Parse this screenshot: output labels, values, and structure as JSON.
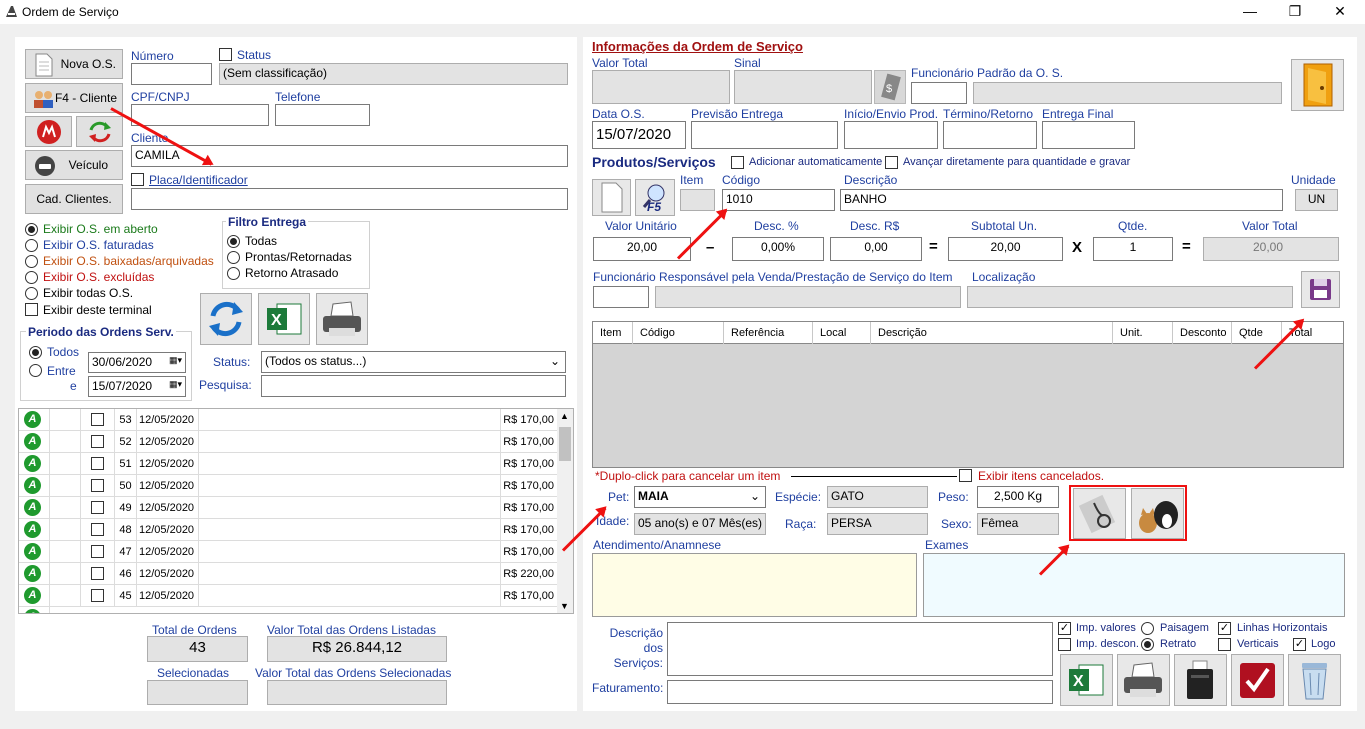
{
  "window": {
    "title": "Ordem de Serviço",
    "minimize": "—",
    "restore": "❐",
    "close": "✕"
  },
  "left": {
    "buttons": {
      "nova_os": "Nova O.S.",
      "f4_cliente": "F4 - Cliente",
      "veiculo": "Veículo",
      "cad_clientes": "Cad. Clientes."
    },
    "numero_label": "Número",
    "status_label": "Status",
    "status_value": "(Sem classificação)",
    "cpf_label": "CPF/CNPJ",
    "telefone_label": "Telefone",
    "cliente_label": "Cliente",
    "cliente_value": "CAMILA",
    "placa_label": "Placa/Identificador",
    "filters": [
      {
        "label": "Exibir O.S. em aberto",
        "color": "#1a7a1a",
        "on": true
      },
      {
        "label": "Exibir O.S. faturadas",
        "color": "#1f3fa0",
        "on": false
      },
      {
        "label": "Exibir O.S. baixadas/arquivadas",
        "color": "#c05010",
        "on": false
      },
      {
        "label": "Exibir O.S. excluídas",
        "color": "#c01010",
        "on": false
      },
      {
        "label": "Exibir todas O.S.",
        "color": "#000000",
        "on": false
      }
    ],
    "exibir_terminal": "Exibir deste terminal",
    "filtro_entrega": {
      "title": "Filtro Entrega",
      "options": [
        "Todas",
        "Prontas/Retornadas",
        "Retorno Atrasado"
      ]
    },
    "periodo": {
      "title": "Periodo das Ordens Serv.",
      "todos": "Todos",
      "entre": "Entre",
      "e": "e",
      "de": "30/06/2020",
      "ate": "15/07/2020"
    },
    "status_filter_label": "Status:",
    "status_filter_value": "(Todos os status...)",
    "pesquisa_label": "Pesquisa:",
    "orders": [
      {
        "num": "53",
        "date": "12/05/2020",
        "value": "R$ 170,00"
      },
      {
        "num": "52",
        "date": "12/05/2020",
        "value": "R$ 170,00"
      },
      {
        "num": "51",
        "date": "12/05/2020",
        "value": "R$ 170,00"
      },
      {
        "num": "50",
        "date": "12/05/2020",
        "value": "R$ 170,00"
      },
      {
        "num": "49",
        "date": "12/05/2020",
        "value": "R$ 170,00"
      },
      {
        "num": "48",
        "date": "12/05/2020",
        "value": "R$ 170,00"
      },
      {
        "num": "47",
        "date": "12/05/2020",
        "value": "R$ 170,00"
      },
      {
        "num": "46",
        "date": "12/05/2020",
        "value": "R$ 220,00"
      },
      {
        "num": "45",
        "date": "12/05/2020",
        "value": "R$ 170,00"
      }
    ],
    "order_icon_letter": "A",
    "totals": {
      "total_ordens_label": "Total de Ordens",
      "total_ordens": "43",
      "valor_total_label": "Valor Total das Ordens Listadas",
      "valor_total": "R$ 26.844,12",
      "selecionadas_label": "Selecionadas",
      "valor_sel_label": "Valor Total das Ordens Selecionadas"
    }
  },
  "right": {
    "info_title": "Informações da Ordem de Serviço",
    "valor_total_label": "Valor Total",
    "sinal_label": "Sinal",
    "func_padrao_label": "Funcionário Padrão da O. S.",
    "data_os_label": "Data O.S.",
    "data_os": "15/07/2020",
    "previsao_label": "Previsão Entrega",
    "inicio_label": "Início/Envio Prod.",
    "termino_label": "Término/Retorno",
    "entrega_label": "Entrega Final",
    "produtos_title": "Produtos/Serviços",
    "adicionar_auto": "Adicionar automaticamente",
    "avancar": "Avançar diretamente para quantidade e gravar",
    "item_label": "Item",
    "codigo_label": "Código",
    "codigo": "1010",
    "descricao_label": "Descrição",
    "descricao": "BANHO",
    "unidade_label": "Unidade",
    "unidade": "UN",
    "valor_unit_label": "Valor Unitário",
    "valor_unit": "20,00",
    "desc_pct_label": "Desc. %",
    "desc_pct": "0,00%",
    "desc_rs_label": "Desc. R$",
    "desc_rs": "0,00",
    "subtotal_label": "Subtotal Un.",
    "subtotal": "20,00",
    "qtde_label": "Qtde.",
    "qtde": "1",
    "valor_total_item_label": "Valor Total",
    "valor_total_item": "20,00",
    "minus": "–",
    "equals": "=",
    "times": "X",
    "func_resp_label": "Funcionário Responsável pela Venda/Prestação de Serviço do Item",
    "localizacao_label": "Localização",
    "grid_cols": [
      "Item",
      "Código",
      "Referência",
      "Local",
      "Descrição",
      "Unit.",
      "Desconto",
      "Qtde",
      "Total"
    ],
    "duplo_click": "*Duplo-click para cancelar um item",
    "exibir_cancelados": "Exibir itens cancelados.",
    "pet_label": "Pet:",
    "pet": "MAIA",
    "especie_label": "Espécie:",
    "especie": "GATO",
    "peso_label": "Peso:",
    "peso": "2,500 Kg",
    "idade_label": "Idade:",
    "idade": "05 ano(s) e 07 Mês(es)",
    "raca_label": "Raça:",
    "raca": "PERSA",
    "sexo_label": "Sexo:",
    "sexo": "Fêmea",
    "atendimento_label": "Atendimento/Anamnese",
    "exames_label": "Exames",
    "descricao_servicos_label": [
      "Descrição",
      "dos",
      "Serviços:"
    ],
    "faturamento_label": "Faturamento:",
    "print_opts": {
      "imp_valores": "Imp. valores",
      "paisagem": "Paisagem",
      "linhas_h": "Linhas Horizontais",
      "imp_descon": "Imp. descon.",
      "retrato": "Retrato",
      "verticais": "Verticais",
      "logo": "Logo"
    },
    "f5": "F5"
  },
  "colors": {
    "accent_blue": "#1f3fa0",
    "header_red": "#a01010",
    "highlight_red": "#e11111"
  }
}
